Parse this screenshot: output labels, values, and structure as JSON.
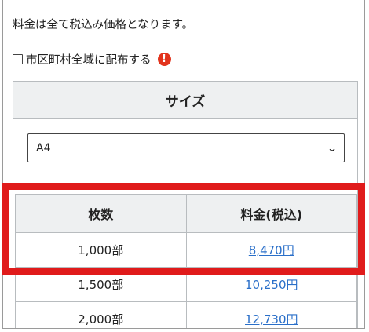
{
  "notice": "料金は全て税込み価格となります。",
  "distribute_all": {
    "label": "市区町村全域に配布する",
    "checked": false,
    "warning_icon": "exclamation-icon",
    "warning_glyph": "!"
  },
  "size_section": {
    "heading": "サイズ",
    "selected": "A4",
    "chevron": "⌄"
  },
  "price_table": {
    "headers": [
      "枚数",
      "料金(税込)"
    ],
    "rows": [
      {
        "quantity": "1,000部",
        "price": "8,470円"
      },
      {
        "quantity": "1,500部",
        "price": "10,250円"
      },
      {
        "quantity": "2,000部",
        "price": "12,730円"
      }
    ]
  },
  "colors": {
    "highlight": "#e01b1b",
    "link": "#2a6fc9",
    "warning": "#e2341d",
    "header_bg": "#eef0f1"
  }
}
